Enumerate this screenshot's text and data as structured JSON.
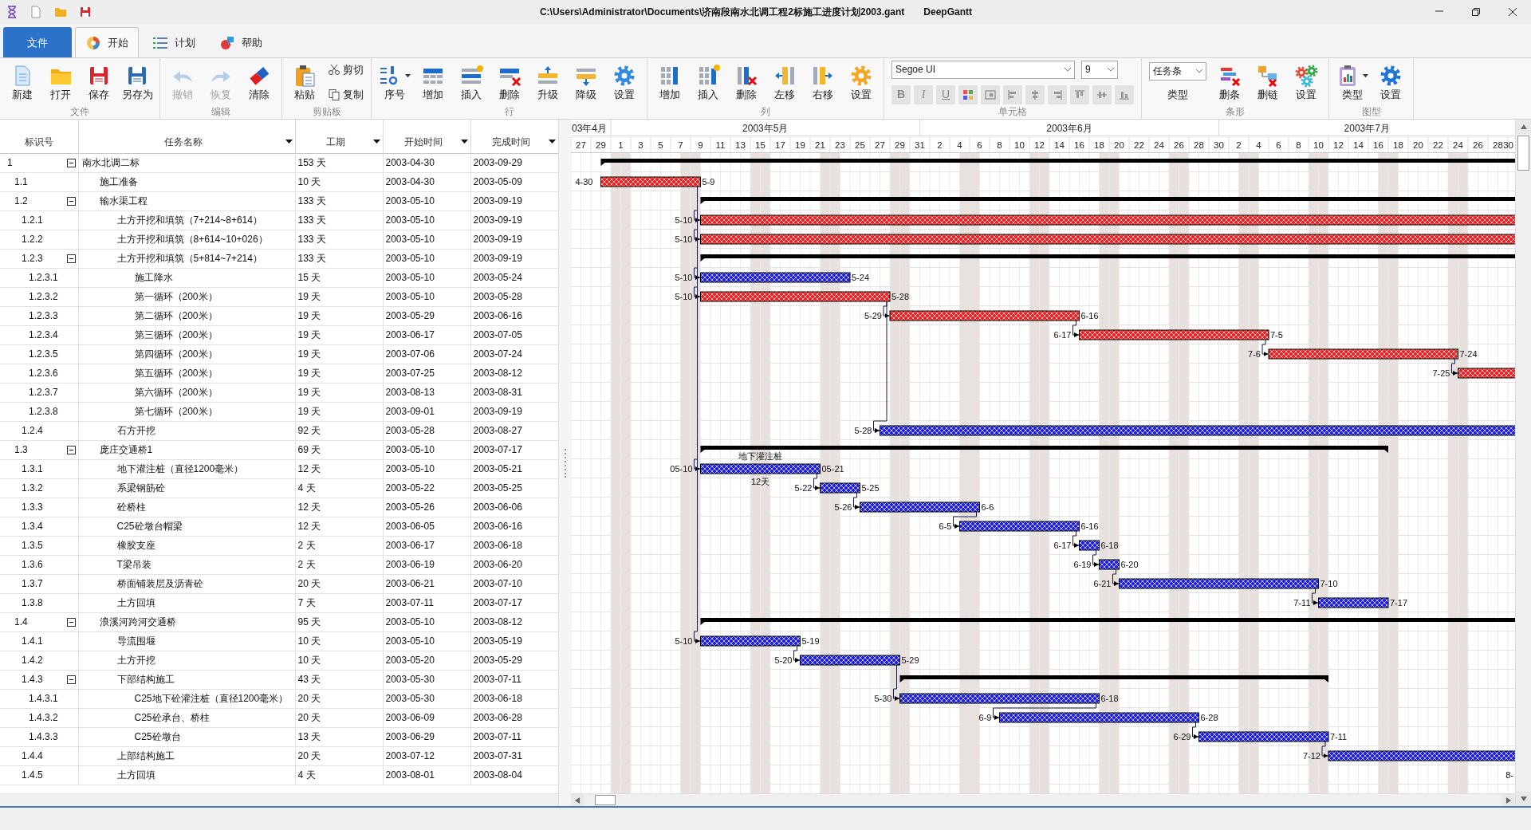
{
  "title_bar": {
    "title": "C:\\Users\\Administrator\\Documents\\济南段南水北调工程2标施工进度计划2003.gant",
    "app_name": "DeepGantt"
  },
  "ribbon": {
    "tabs": [
      {
        "label": "文件",
        "kind": "file",
        "selected": false
      },
      {
        "label": "开始",
        "kind": "tab",
        "selected": true
      },
      {
        "label": "计划",
        "kind": "tab",
        "selected": false
      },
      {
        "label": "帮助",
        "kind": "tab",
        "selected": false
      }
    ],
    "groups": [
      {
        "label": "文件",
        "items": [
          {
            "kind": "large",
            "label": "新建",
            "disabled": false
          },
          {
            "kind": "large",
            "label": "打开",
            "disabled": false
          },
          {
            "kind": "large",
            "label": "保存",
            "disabled": false
          },
          {
            "kind": "large",
            "label": "另存为",
            "disabled": false
          }
        ]
      },
      {
        "label": "编辑",
        "items": [
          {
            "kind": "large",
            "label": "撤销",
            "disabled": true
          },
          {
            "kind": "large",
            "label": "恢复",
            "disabled": true
          },
          {
            "kind": "large",
            "label": "清除",
            "disabled": false
          }
        ]
      },
      {
        "label": "剪贴板",
        "items": [
          {
            "kind": "large",
            "label": "粘贴",
            "disabled": false
          },
          {
            "kind": "small",
            "label": "剪切",
            "disabled": false
          },
          {
            "kind": "small",
            "label": "复制",
            "disabled": false
          }
        ]
      },
      {
        "label": "行",
        "items": [
          {
            "kind": "large",
            "label": "序号",
            "disabled": false,
            "has_menu": true
          },
          {
            "kind": "large",
            "label": "增加",
            "disabled": false
          },
          {
            "kind": "large",
            "label": "插入",
            "disabled": false
          },
          {
            "kind": "large",
            "label": "删除",
            "disabled": false
          },
          {
            "kind": "large",
            "label": "升级",
            "disabled": false
          },
          {
            "kind": "large",
            "label": "降级",
            "disabled": false
          },
          {
            "kind": "large",
            "label": "设置",
            "disabled": false
          }
        ]
      },
      {
        "label": "列",
        "items": [
          {
            "kind": "large",
            "label": "增加",
            "disabled": false
          },
          {
            "kind": "large",
            "label": "插入",
            "disabled": false
          },
          {
            "kind": "large",
            "label": "删除",
            "disabled": false
          },
          {
            "kind": "large",
            "label": "左移",
            "disabled": false
          },
          {
            "kind": "large",
            "label": "右移",
            "disabled": false
          },
          {
            "kind": "large",
            "label": "设置",
            "disabled": false
          }
        ]
      },
      {
        "label": "单元格",
        "items": [
          {
            "kind": "cell_format",
            "font": "Segoe UI",
            "size": "9",
            "buttons": [
              {
                "label": "B",
                "disabled": true
              },
              {
                "label": "I",
                "disabled": true
              },
              {
                "label": "U",
                "disabled": true
              },
              {
                "disabled": true
              },
              {
                "disabled": true
              },
              {
                "disabled": true
              },
              {
                "disabled": true
              },
              {
                "disabled": true
              },
              {
                "disabled": true
              },
              {
                "disabled": true
              },
              {
                "disabled": true
              }
            ]
          }
        ]
      },
      {
        "label": "条形",
        "items": [
          {
            "kind": "select",
            "value": "任务条",
            "caption": "类型"
          },
          {
            "kind": "large",
            "label": "删条",
            "disabled": false
          },
          {
            "kind": "large",
            "label": "删链",
            "disabled": false
          },
          {
            "kind": "large",
            "label": "设置",
            "disabled": false
          }
        ]
      },
      {
        "label": "图型",
        "items": [
          {
            "kind": "large",
            "label": "类型",
            "disabled": false,
            "has_menu": true
          },
          {
            "kind": "large",
            "label": "设置",
            "disabled": false
          }
        ]
      }
    ]
  },
  "table": {
    "columns": [
      {
        "label": "标识号",
        "dropdown": false
      },
      {
        "label": "任务名称",
        "dropdown": true
      },
      {
        "label": "工期",
        "dropdown": true
      },
      {
        "label": "开始时间",
        "dropdown": true
      },
      {
        "label": "完成时间",
        "dropdown": true
      }
    ],
    "rows": [
      {
        "id": "1",
        "name": "南水北调二标",
        "duration": "153 天",
        "start": "2003-04-30",
        "finish": "2003-09-29",
        "expanded": true,
        "children": [
          {
            "id": "1.1",
            "name": "施工准备",
            "duration": "10 天",
            "start": "2003-04-30",
            "finish": "2003-05-09",
            "critical": true,
            "start_label": "4-30",
            "end_label": "5-9"
          },
          {
            "id": "1.2",
            "name": "输水渠工程",
            "duration": "133 天",
            "start": "2003-05-10",
            "finish": "2003-09-19",
            "expanded": true,
            "children": [
              {
                "id": "1.2.1",
                "name": "土方开挖和填筑（7+214~8+614）",
                "duration": "133 天",
                "start": "2003-05-10",
                "finish": "2003-09-19",
                "critical": true,
                "linked": true,
                "start_label": "5-10"
              },
              {
                "id": "1.2.2",
                "name": "土方开挖和填筑（8+614~10+026）",
                "duration": "133 天",
                "start": "2003-05-10",
                "finish": "2003-09-19",
                "critical": true,
                "linked": true,
                "start_label": "5-10"
              },
              {
                "id": "1.2.3",
                "name": "土方开挖和填筑（5+814~7+214）",
                "duration": "133 天",
                "start": "2003-05-10",
                "finish": "2003-09-19",
                "expanded": true,
                "children": [
                  {
                    "id": "1.2.3.1",
                    "name": "施工降水",
                    "duration": "15 天",
                    "start": "2003-05-10",
                    "finish": "2003-05-24",
                    "critical": false,
                    "linked": true,
                    "start_label": "5-10",
                    "end_label": "5-24"
                  },
                  {
                    "id": "1.2.3.2",
                    "name": "第一循环（200米）",
                    "duration": "19 天",
                    "start": "2003-05-10",
                    "finish": "2003-05-28",
                    "critical": true,
                    "linked": true,
                    "start_label": "5-10",
                    "end_label": "5-28"
                  },
                  {
                    "id": "1.2.3.3",
                    "name": "第二循环（200米）",
                    "duration": "19 天",
                    "start": "2003-05-29",
                    "finish": "2003-06-16",
                    "critical": true,
                    "linked": true,
                    "start_label": "5-29",
                    "end_label": "6-16"
                  },
                  {
                    "id": "1.2.3.4",
                    "name": "第三循环（200米）",
                    "duration": "19 天",
                    "start": "2003-06-17",
                    "finish": "2003-07-05",
                    "critical": true,
                    "linked": true,
                    "start_label": "6-17",
                    "end_label": "7-5"
                  },
                  {
                    "id": "1.2.3.5",
                    "name": "第四循环（200米）",
                    "duration": "19 天",
                    "start": "2003-07-06",
                    "finish": "2003-07-24",
                    "critical": true,
                    "linked": true,
                    "start_label": "7-6",
                    "end_label": "7-24"
                  },
                  {
                    "id": "1.2.3.6",
                    "name": "第五循环（200米）",
                    "duration": "19 天",
                    "start": "2003-07-25",
                    "finish": "2003-08-12",
                    "critical": true,
                    "linked": true,
                    "start_label": "7-25"
                  },
                  {
                    "id": "1.2.3.7",
                    "name": "第六循环（200米）",
                    "duration": "19 天",
                    "start": "2003-08-13",
                    "finish": "2003-08-31"
                  },
                  {
                    "id": "1.2.3.8",
                    "name": "第七循环（200米）",
                    "duration": "19 天",
                    "start": "2003-09-01",
                    "finish": "2003-09-19"
                  }
                ]
              },
              {
                "id": "1.2.4",
                "name": "石方开挖",
                "duration": "92 天",
                "start": "2003-05-28",
                "finish": "2003-08-27",
                "critical": false,
                "linked": true,
                "start_label": "5-28"
              }
            ]
          },
          {
            "id": "1.3",
            "name": "庞庄交通桥1",
            "duration": "69 天",
            "start": "2003-05-10",
            "finish": "2003-07-17",
            "expanded": true,
            "children": [
              {
                "id": "1.3.1",
                "name": "地下灌注桩（直径1200毫米）",
                "duration": "12 天",
                "start": "2003-05-10",
                "finish": "2003-05-21",
                "critical": false,
                "linked": true,
                "start_label": "05-10",
                "end_label": "05-21",
                "top_label": "地下灌注桩",
                "bottom_label": "12天"
              },
              {
                "id": "1.3.2",
                "name": "系梁钢筋砼",
                "duration": "4 天",
                "start": "2003-05-22",
                "finish": "2003-05-25",
                "critical": false,
                "linked": true,
                "start_label": "5-22",
                "end_label": "5-25"
              },
              {
                "id": "1.3.3",
                "name": "砼桥柱",
                "duration": "12 天",
                "start": "2003-05-26",
                "finish": "2003-06-06",
                "critical": false,
                "linked": true,
                "start_label": "5-26",
                "end_label": "6-6"
              },
              {
                "id": "1.3.4",
                "name": "C25砼墩台帽梁",
                "duration": "12 天",
                "start": "2003-06-05",
                "finish": "2003-06-16",
                "critical": false,
                "linked": true,
                "start_label": "6-5",
                "end_label": "6-16"
              },
              {
                "id": "1.3.5",
                "name": "橡胶支座",
                "duration": "2 天",
                "start": "2003-06-17",
                "finish": "2003-06-18",
                "critical": false,
                "linked": true,
                "start_label": "6-17",
                "end_label": "6-18"
              },
              {
                "id": "1.3.6",
                "name": "T梁吊装",
                "duration": "2 天",
                "start": "2003-06-19",
                "finish": "2003-06-20",
                "critical": false,
                "linked": true,
                "start_label": "6-19",
                "end_label": "6-20"
              },
              {
                "id": "1.3.7",
                "name": "桥面铺装层及沥青砼",
                "duration": "20 天",
                "start": "2003-06-21",
                "finish": "2003-07-10",
                "critical": false,
                "linked": true,
                "start_label": "6-21",
                "end_label": "7-10"
              },
              {
                "id": "1.3.8",
                "name": "土方回填",
                "duration": "7 天",
                "start": "2003-07-11",
                "finish": "2003-07-17",
                "critical": false,
                "linked": true,
                "start_label": "7-11",
                "end_label": "7-17"
              }
            ]
          },
          {
            "id": "1.4",
            "name": "浪溪河跨河交通桥",
            "duration": "95 天",
            "start": "2003-05-10",
            "finish": "2003-08-12",
            "expanded": true,
            "children": [
              {
                "id": "1.4.1",
                "name": "导流围堰",
                "duration": "10 天",
                "start": "2003-05-10",
                "finish": "2003-05-19",
                "critical": false,
                "linked": true,
                "start_label": "5-10",
                "end_label": "5-19"
              },
              {
                "id": "1.4.2",
                "name": "土方开挖",
                "duration": "10 天",
                "start": "2003-05-20",
                "finish": "2003-05-29",
                "critical": false,
                "linked": true,
                "start_label": "5-20",
                "end_label": "5-29"
              },
              {
                "id": "1.4.3",
                "name": "下部结构施工",
                "duration": "43 天",
                "start": "2003-05-30",
                "finish": "2003-07-11",
                "expanded": true,
                "children": [
                  {
                    "id": "1.4.3.1",
                    "name": "C25地下砼灌注桩（直径1200毫米）",
                    "duration": "20 天",
                    "start": "2003-05-30",
                    "finish": "2003-06-18",
                    "critical": false,
                    "linked": true,
                    "start_label": "5-30",
                    "end_label": "6-18"
                  },
                  {
                    "id": "1.4.3.2",
                    "name": "C25砼承台、桥柱",
                    "duration": "20 天",
                    "start": "2003-06-09",
                    "finish": "2003-06-28",
                    "critical": false,
                    "linked": true,
                    "start_label": "6-9",
                    "end_label": "6-28"
                  },
                  {
                    "id": "1.4.3.3",
                    "name": "C25砼墩台",
                    "duration": "13 天",
                    "start": "2003-06-29",
                    "finish": "2003-07-11",
                    "critical": false,
                    "linked": true,
                    "start_label": "6-29",
                    "end_label": "7-11"
                  }
                ]
              },
              {
                "id": "1.4.4",
                "name": "上部结构施工",
                "duration": "20 天",
                "start": "2003-07-12",
                "finish": "2003-07-31",
                "critical": false,
                "linked": true,
                "start_label": "7-12"
              },
              {
                "id": "1.4.5",
                "name": "土方回填",
                "duration": "4 天",
                "start": "2003-08-01",
                "finish": "2003-08-04",
                "start_label": "8-"
              }
            ]
          }
        ]
      }
    ]
  },
  "gantt": {
    "months": [
      "03年4月",
      "2003年5月",
      "2003年6月",
      "2003年7月"
    ],
    "days": [
      "27",
      "29",
      "1",
      "3",
      "5",
      "7",
      "9",
      "11",
      "13",
      "15",
      "17",
      "19",
      "21",
      "23",
      "25",
      "27",
      "29",
      "31",
      "2",
      "4",
      "6",
      "8",
      "10",
      "12",
      "14",
      "16",
      "18",
      "20",
      "22",
      "24",
      "26",
      "28",
      "30",
      "2",
      "4",
      "6",
      "8",
      "10",
      "12",
      "14",
      "16",
      "18",
      "20",
      "22",
      "24",
      "26",
      "28",
      "30"
    ]
  }
}
